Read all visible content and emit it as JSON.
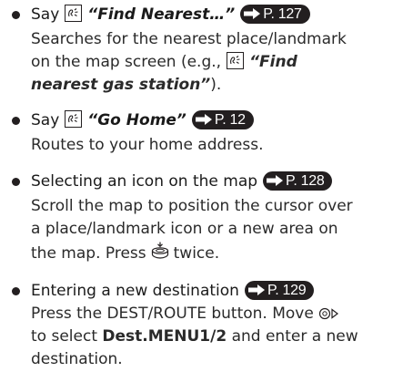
{
  "items": [
    {
      "heading_prefix": "Say",
      "heading_quote": "“Find Nearest…”",
      "page_ref": "P. 127",
      "body_line1": "Searches for the nearest place/landmark",
      "body_line2_pre": "on the map screen (e.g.,",
      "body_line2_quote": "“Find",
      "body_line3_quote": "nearest gas station”",
      "body_line3_post": ")."
    },
    {
      "heading_prefix": "Say",
      "heading_quote": "“Go Home”",
      "page_ref": "P. 12",
      "body_line1": "Routes to your home address."
    },
    {
      "heading": "Selecting an icon on the map",
      "page_ref": "P. 128",
      "body_line1": "Scroll the map to position the cursor over",
      "body_line2": "a place/landmark icon or a new area on",
      "body_line3_pre": "the map. Press",
      "body_line3_post": "twice."
    },
    {
      "heading": "Entering a new destination",
      "page_ref": "P. 129",
      "body_line1": "Press the DEST/ROUTE button. Move",
      "body_line2_pre": "to select",
      "body_line2_bold": "Dest.MENU1/2",
      "body_line2_post": "and enter a new",
      "body_line3": "destination."
    }
  ],
  "icons": {
    "voice": "talk-voice-icon",
    "arrow": "right-arrow-icon",
    "dial": "interface-dial-push-icon",
    "joystick": "joystick-right-icon"
  }
}
